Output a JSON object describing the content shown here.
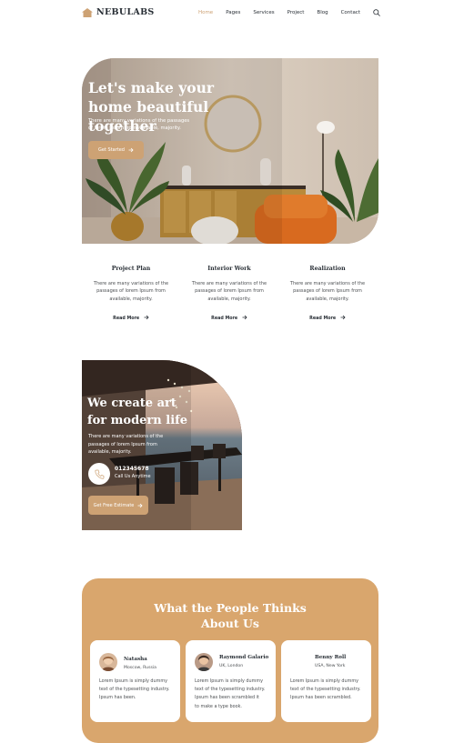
{
  "brand": {
    "name": "NEBULABS"
  },
  "nav": {
    "items": [
      "Home",
      "Pages",
      "Services",
      "Project",
      "Blog",
      "Contact"
    ],
    "active": "Home"
  },
  "hero": {
    "title_line1": "Let's make your",
    "title_line2": "home beautiful together",
    "subtitle_line1": "There are many variations of the passages",
    "subtitle_line2": "of lorem Ipsum fromavailable, majority.",
    "cta": "Get Started"
  },
  "services": [
    {
      "title": "Project Plan",
      "text_line1": "There are many variations of the",
      "text_line2": "passages of lorem Ipsum from",
      "text_line3": "available, majority.",
      "link": "Read More"
    },
    {
      "title": "Interior Work",
      "text_line1": "There are many variations of the",
      "text_line2": "passages of lorem Ipsum from",
      "text_line3": "available, majority.",
      "link": "Read More"
    },
    {
      "title": "Realization",
      "text_line1": "There are many variations of the",
      "text_line2": "passages of lorem Ipsum from",
      "text_line3": "available, majority.",
      "link": "Read More"
    }
  ],
  "hero2": {
    "title_line1": "We create art",
    "title_line2": "for modern life",
    "subtitle_line1": "There are many variations of the",
    "subtitle_line2": "passages of lorem Ipsum from",
    "subtitle_line3": "available, majority.",
    "phone": "012345678",
    "phone_label": "Call Us Anytime",
    "cta": "Get Free Estimate"
  },
  "testimonials": {
    "title_line1": "What the People Thinks",
    "title_line2": "About Us",
    "cards": [
      {
        "name": "Natasha",
        "location": "Moscow, Russia",
        "text_line1": "Lorem Ipsum is simply dummy",
        "text_line2": "text of the typesetting industry.",
        "text_line3": "Ipsum has been.",
        "text_line4": ""
      },
      {
        "name": "Raymond Galario",
        "location": "UK, London",
        "text_line1": "Lorem Ipsum is simply dummy",
        "text_line2": "text of the typesetting industry.",
        "text_line3": "Ipsum has been scrambled it",
        "text_line4": "to make a type book."
      },
      {
        "name": "Benny Roll",
        "location": "USA, New York",
        "text_line1": "Lorem Ipsum is simply dummy",
        "text_line2": "text of the typesetting industry.",
        "text_line3": "Ipsum has been scrambled.",
        "text_line4": ""
      }
    ]
  },
  "colors": {
    "accent": "#cda274",
    "dark": "#292f36",
    "testimonial_bg": "#d9a66d"
  }
}
